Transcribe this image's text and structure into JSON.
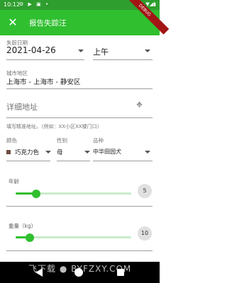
{
  "status_bar": {
    "time": "10:12",
    "icons": "⚙ ▶ ▣ •",
    "system": "▼◢▮"
  },
  "debug_banner": "DEBUG",
  "app_bar": {
    "close_glyph": "✕",
    "title": "报告失踪汪"
  },
  "form": {
    "lost_date": {
      "label": "失踪日期",
      "value": "2021-04-26"
    },
    "time_of_day": {
      "value": "上午"
    },
    "city": {
      "label": "城市地区",
      "value": "上海市 - 上海市 - 静安区"
    },
    "address": {
      "placeholder": "详细地址",
      "hint": "填写精准地址。（例如：XX小区XX楼门口）",
      "locate_glyph": "⌖"
    },
    "color": {
      "label": "颜色",
      "value": "巧克力色",
      "swatch": "#6d4c41"
    },
    "gender": {
      "label": "性别",
      "value": "母"
    },
    "breed": {
      "label": "品种",
      "value": "中华田园犬"
    },
    "age": {
      "label": "年龄",
      "value": "5",
      "fraction": 0.18
    },
    "weight": {
      "label": "重量（kg）",
      "value": "10",
      "fraction": 0.12
    }
  },
  "watermark": "飞下载 ● BYFZXY.COM",
  "colors": {
    "primary": "#2fbf2f",
    "status": "#2e9e2e"
  }
}
